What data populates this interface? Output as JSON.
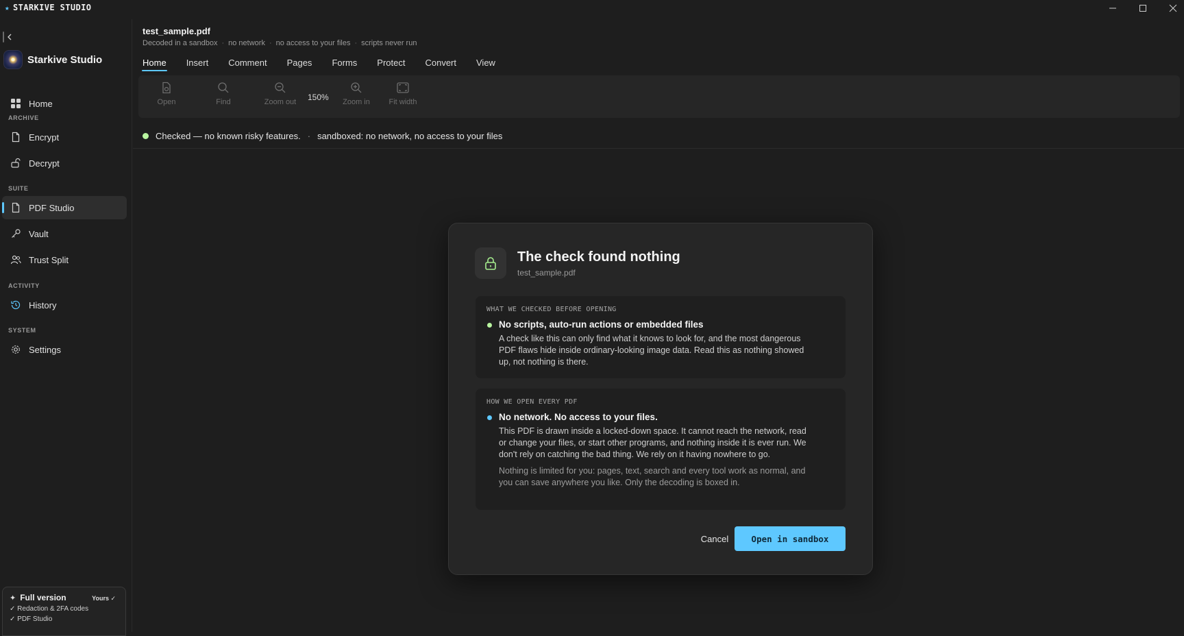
{
  "titlebar": {
    "brand": "STARKIVE STUDIO"
  },
  "sidebar": {
    "app_name": "Starkive Studio",
    "home": "Home",
    "sections": {
      "archive": "ARCHIVE",
      "suite": "SUITE",
      "activity": "ACTIVITY",
      "system": "SYSTEM"
    },
    "items": {
      "encrypt": "Encrypt",
      "decrypt": "Decrypt",
      "pdf_studio": "PDF Studio",
      "vault": "Vault",
      "trust_split": "Trust Split",
      "history": "History",
      "settings": "Settings"
    },
    "license": {
      "title": "Full version",
      "badge": "Yours ✓",
      "features": [
        "✓ Redaction & 2FA codes",
        "✓ PDF Studio"
      ]
    }
  },
  "document": {
    "filename": "test_sample.pdf",
    "meta": [
      "Decoded in a sandbox",
      "no network",
      "no access to your files",
      "scripts never run"
    ]
  },
  "tabs": [
    "Home",
    "Insert",
    "Comment",
    "Pages",
    "Forms",
    "Protect",
    "Convert",
    "View"
  ],
  "toolbar": {
    "open": "Open",
    "find": "Find",
    "zoom_out": "Zoom out",
    "zoom_level": "150%",
    "zoom_in": "Zoom in",
    "fit_width": "Fit width"
  },
  "status": {
    "checked": "Checked — no known risky features.",
    "sandbox": "sandboxed: no network, no access to your files"
  },
  "dialog": {
    "title": "The check found nothing",
    "subtitle": "test_sample.pdf",
    "panel1": {
      "label": "WHAT WE CHECKED BEFORE OPENING",
      "heading": "No scripts, auto-run actions or embedded files",
      "body": "A check like this can only find what it knows to look for, and the most dangerous PDF flaws hide inside ordinary-looking image data. Read this as nothing showed up, not nothing is there."
    },
    "panel2": {
      "label": "HOW WE OPEN EVERY PDF",
      "heading": "No network. No access to your files.",
      "body": "This PDF is drawn inside a locked-down space. It cannot reach the network, read or change your files, or start other programs, and nothing inside it is ever run. We don't rely on catching the bad thing. We rely on it having nowhere to go.",
      "note": "Nothing is limited for you: pages, text, search and every tool work as normal, and you can save anywhere you like. Only the decoding is boxed in."
    },
    "cancel": "Cancel",
    "open": "Open in sandbox"
  },
  "colors": {
    "accent": "#5ec8ff",
    "ok": "#b9f5a0",
    "info_dot": "#5ec8ff"
  }
}
